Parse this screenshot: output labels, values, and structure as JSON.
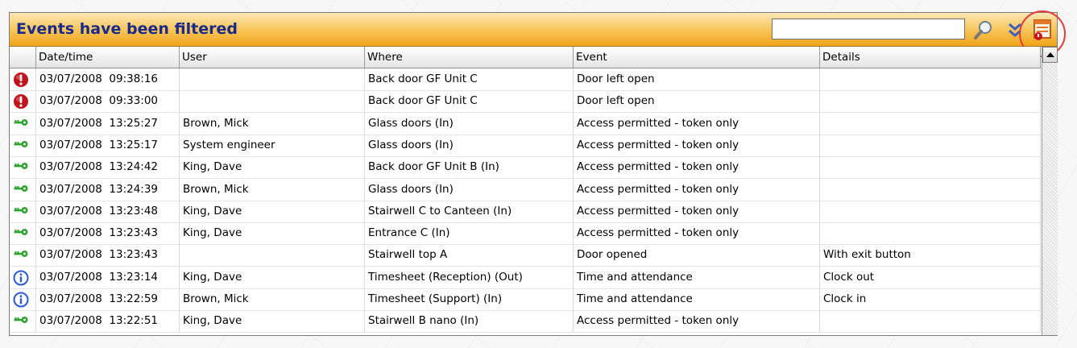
{
  "panel": {
    "title": "Events have been filtered",
    "search": {
      "value": "",
      "placeholder": ""
    }
  },
  "toolbar_icons": [
    "search-icon",
    "double-chevron-down-icon",
    "filter-icon"
  ],
  "grid": {
    "columns": [
      "Date/time",
      "User",
      "Where",
      "Event",
      "Details"
    ],
    "rows": [
      {
        "icon": "alarm-icon",
        "datetime": "03/07/2008  09:38:16",
        "user": "",
        "where": "Back door GF Unit C",
        "event": "Door left open",
        "details": ""
      },
      {
        "icon": "alarm-icon",
        "datetime": "03/07/2008  09:33:00",
        "user": "",
        "where": "Back door GF Unit C",
        "event": "Door left open",
        "details": ""
      },
      {
        "icon": "key-icon",
        "datetime": "03/07/2008  13:25:27",
        "user": "Brown, Mick",
        "where": "Glass doors (In)",
        "event": "Access permitted - token only",
        "details": ""
      },
      {
        "icon": "key-icon",
        "datetime": "03/07/2008  13:25:17",
        "user": "System engineer",
        "where": "Glass doors (In)",
        "event": "Access permitted - token only",
        "details": ""
      },
      {
        "icon": "key-icon",
        "datetime": "03/07/2008  13:24:42",
        "user": "King, Dave",
        "where": "Back door GF Unit B (In)",
        "event": "Access permitted - token only",
        "details": ""
      },
      {
        "icon": "key-icon",
        "datetime": "03/07/2008  13:24:39",
        "user": "Brown, Mick",
        "where": "Glass doors (In)",
        "event": "Access permitted - token only",
        "details": ""
      },
      {
        "icon": "key-icon",
        "datetime": "03/07/2008  13:23:48",
        "user": "King, Dave",
        "where": "Stairwell C to Canteen (In)",
        "event": "Access permitted - token only",
        "details": ""
      },
      {
        "icon": "key-icon",
        "datetime": "03/07/2008  13:23:43",
        "user": "King, Dave",
        "where": "Entrance C (In)",
        "event": "Access permitted - token only",
        "details": ""
      },
      {
        "icon": "key-icon",
        "datetime": "03/07/2008  13:23:43",
        "user": "",
        "where": "Stairwell top A",
        "event": "Door opened",
        "details": "With exit button"
      },
      {
        "icon": "info-icon",
        "datetime": "03/07/2008  13:23:14",
        "user": "King, Dave",
        "where": "Timesheet (Reception) (Out)",
        "event": "Time and attendance",
        "details": "Clock out"
      },
      {
        "icon": "info-icon",
        "datetime": "03/07/2008  13:22:59",
        "user": "Brown, Mick",
        "where": "Timesheet (Support) (In)",
        "event": "Time and attendance",
        "details": "Clock in"
      },
      {
        "icon": "key-icon",
        "datetime": "03/07/2008  13:22:51",
        "user": "King, Dave",
        "where": "Stairwell B nano (In)",
        "event": "Access permitted - token only",
        "details": ""
      }
    ]
  },
  "colors": {
    "title_text": "#1a2a8a",
    "alarm": "#c0141c",
    "key": "#2fa32f",
    "info": "#2a58d8",
    "highlight_circle": "#e23a3a"
  }
}
